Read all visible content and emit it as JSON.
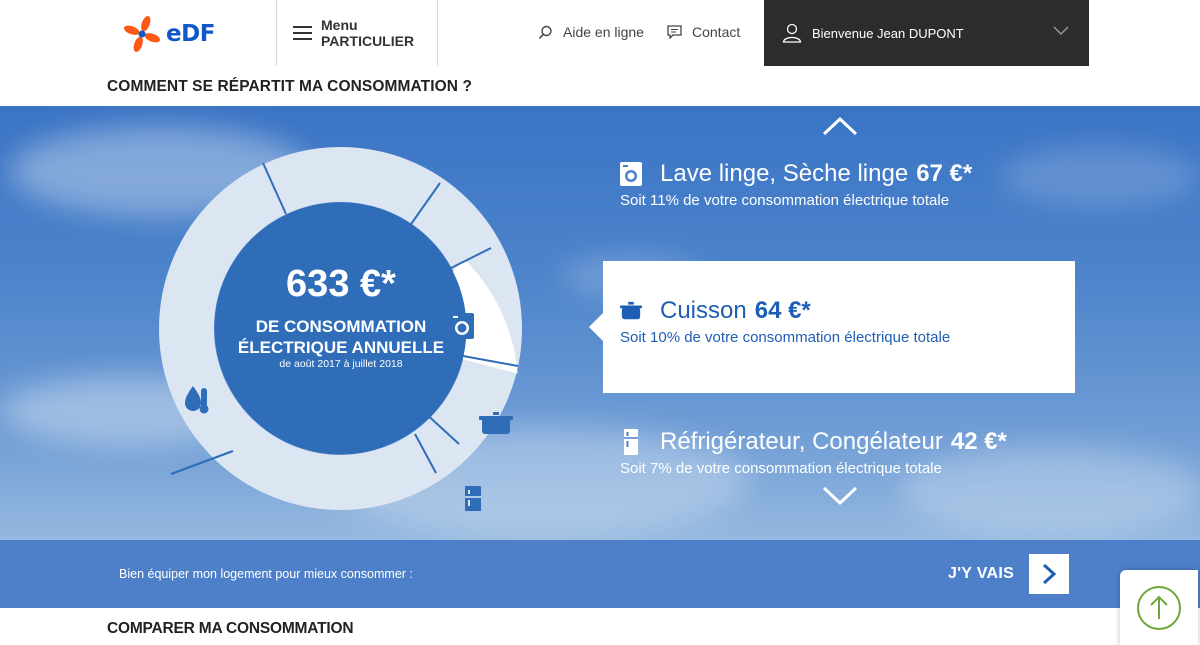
{
  "header": {
    "logo_text": "eDF",
    "menu_label": "Menu",
    "menu_sub": "PARTICULIER",
    "help_label": "Aide en ligne",
    "contact_label": "Contact",
    "welcome": "Bienvenue Jean DUPONT"
  },
  "section_title": "COMMENT SE RÉPARTIT MA CONSOMMATION ?",
  "summary": {
    "amount": "633 €*",
    "label_line1": "DE CONSOMMATION",
    "label_line2": "ÉLECTRIQUE ANNUELLE",
    "period": "de août 2017 à juillet 2018"
  },
  "items": [
    {
      "icon": "washing-machine-icon",
      "name": "Lave linge, Sèche linge",
      "amount": "67 €*",
      "share": "Soit 11% de votre consommation électrique totale",
      "active": false
    },
    {
      "icon": "cooking-pot-icon",
      "name": "Cuisson",
      "amount": "64 €*",
      "share": "Soit 10% de votre consommation électrique totale",
      "active": true
    },
    {
      "icon": "fridge-icon",
      "name": "Réfrigérateur, Congélateur",
      "amount": "42 €*",
      "share": "Soit 7% de votre consommation électrique totale",
      "active": false
    }
  ],
  "banner": {
    "text": "Bien équiper mon logement pour mieux consommer :",
    "cta": "J'Y VAIS"
  },
  "compare_title": "COMPARER MA CONSOMMATION",
  "colors": {
    "brand_blue": "#1057c8",
    "brand_orange": "#fe5815",
    "active_text": "#1f5eb5",
    "header_dark": "#2c2c2c",
    "banner": "#4d80c8",
    "scroll_green": "#6fa53b"
  }
}
